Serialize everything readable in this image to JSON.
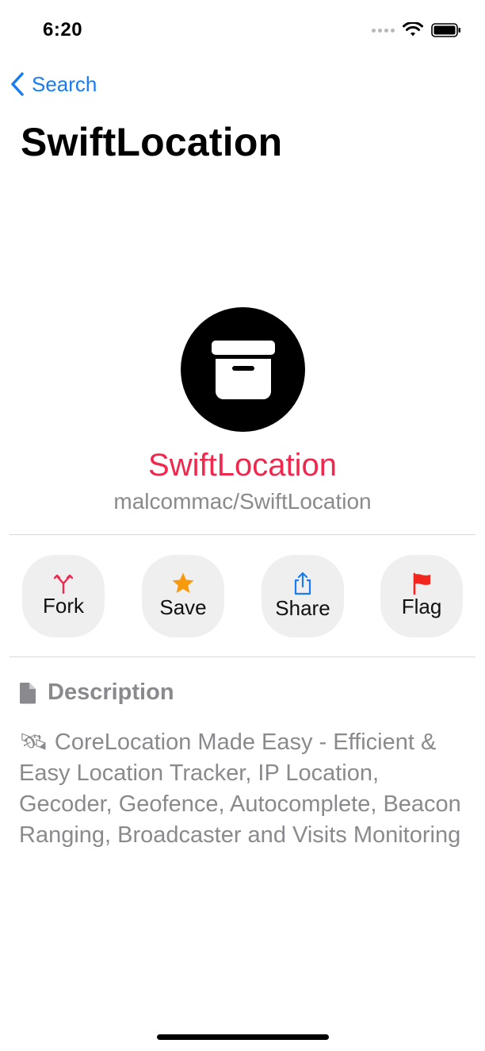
{
  "status_bar": {
    "time": "6:20"
  },
  "nav": {
    "back_label": "Search"
  },
  "page": {
    "title": "SwiftLocation"
  },
  "repo": {
    "name": "SwiftLocation",
    "full_name": "malcommac/SwiftLocation",
    "icon": "archive-box-icon"
  },
  "actions": [
    {
      "label": "Fork",
      "icon": "fork-icon",
      "color": "#f0284e"
    },
    {
      "label": "Save",
      "icon": "star-icon",
      "color": "#f79a0e"
    },
    {
      "label": "Share",
      "icon": "share-icon",
      "color": "#1a7cf2"
    },
    {
      "label": "Flag",
      "icon": "flag-icon",
      "color": "#f2261c"
    }
  ],
  "description": {
    "heading": "Description",
    "text": "🛰 CoreLocation Made Easy - Efficient & Easy Location Tracker, IP Location, Gecoder, Geofence, Autocomplete, Beacon Ranging, Broadcaster and Visits Monitoring"
  },
  "colors": {
    "accent": "#1a7cf2",
    "repo_name": "#f0284e",
    "secondary_text": "#8a8a8e"
  }
}
